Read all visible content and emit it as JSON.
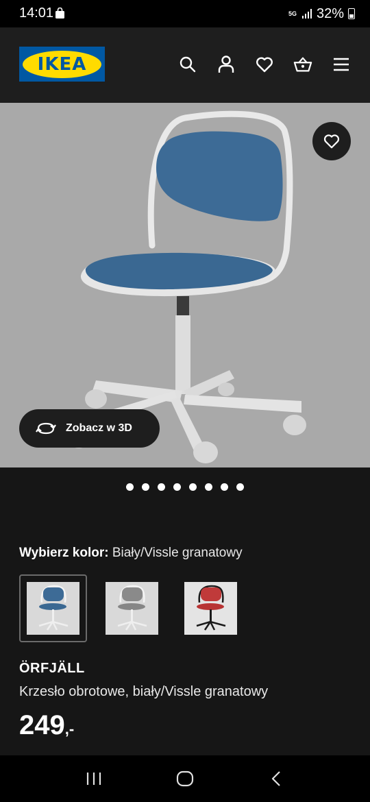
{
  "status_bar": {
    "time": "14:01",
    "network": "5G",
    "battery": "32%"
  },
  "header": {
    "logo_text": "IKEA",
    "icons": [
      "search-icon",
      "account-icon",
      "heart-icon",
      "basket-icon",
      "menu-icon"
    ],
    "colors": {
      "background": "#1e1e1e",
      "logo_blue": "#0058a3",
      "logo_yellow": "#ffdb00"
    }
  },
  "gallery": {
    "view3d_label": "Zobacz w 3D",
    "dot_count": 8,
    "background": "#a9a9a9"
  },
  "product": {
    "color_label": "Wybierz kolor:",
    "color_value": "Biały/Vissle granatowy",
    "swatches": [
      {
        "name": "Biały/Vissle granatowy",
        "seat": "#3b6a94",
        "frame": "#f0f0f0",
        "selected": true
      },
      {
        "name": "Biały/Vissle szary",
        "seat": "#8a8a8a",
        "frame": "#f0f0f0",
        "selected": false
      },
      {
        "name": "Czarny/Vissle czerwony",
        "seat": "#c03a3a",
        "frame": "#1a1a1a",
        "selected": false
      }
    ],
    "name": "ÖRFJÄLL",
    "description": "Krzesło obrotowe, biały/Vissle granatowy",
    "price_int": "249",
    "price_dec": ",-"
  },
  "nav": {
    "icons": [
      "recent-apps-icon",
      "home-icon",
      "back-icon"
    ]
  }
}
